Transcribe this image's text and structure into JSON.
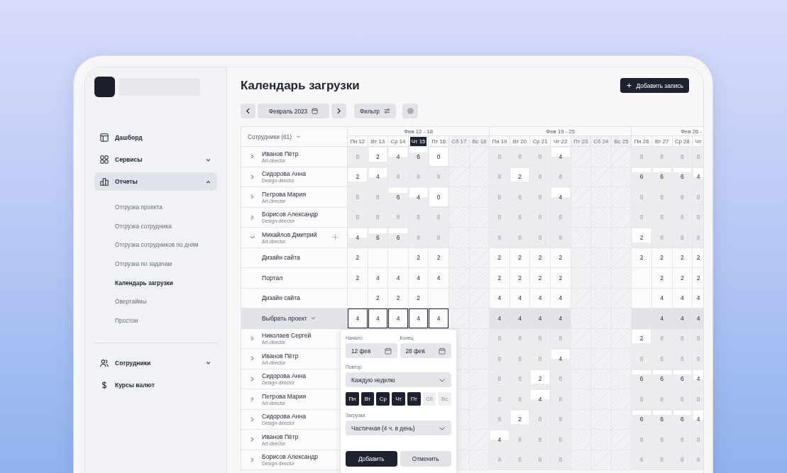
{
  "sidebar": {
    "nav": [
      {
        "label": "Дашборд",
        "kind": "link",
        "selected": false
      },
      {
        "label": "Сервисы",
        "kind": "group",
        "expanded": false,
        "selected": false
      },
      {
        "label": "Отчеты",
        "kind": "group",
        "expanded": true,
        "selected": true,
        "children": [
          {
            "label": "Отгрузка проекта",
            "selected": false
          },
          {
            "label": "Отгрузка сотрудника",
            "selected": false
          },
          {
            "label": "Отгрузка сотрудников по дням",
            "selected": false
          },
          {
            "label": "Отгрузка по задачам",
            "selected": false
          },
          {
            "label": "Календарь загрузки",
            "selected": true
          },
          {
            "label": "Овертаймы",
            "selected": false
          },
          {
            "label": "Простои",
            "selected": false
          }
        ]
      }
    ],
    "nav_bottom": [
      {
        "label": "Сотрудники",
        "kind": "group",
        "expanded": false,
        "selected": false
      },
      {
        "label": "Курсы валют",
        "kind": "link",
        "selected": false
      }
    ]
  },
  "title": "Календарь загрузки",
  "add_button": "Добавить запись",
  "month": "Февраль 2023",
  "filter_button": "Фильтр",
  "employees_header": "Сотрудники (61)",
  "weeks": [
    {
      "label": "Фев 12 - 18"
    },
    {
      "label": "Фев 19 - 25"
    },
    {
      "label": "Фев 26 -"
    }
  ],
  "days": [
    {
      "label": "Пн 12",
      "day_off": false,
      "today": false
    },
    {
      "label": "Вт 13",
      "day_off": false,
      "today": false
    },
    {
      "label": "Ср 14",
      "day_off": false,
      "today": false
    },
    {
      "label": "Чт 15",
      "day_off": false,
      "today": true
    },
    {
      "label": "Пт 16",
      "day_off": false,
      "today": false
    },
    {
      "label": "Сб 17",
      "day_off": true,
      "today": false
    },
    {
      "label": "Вс 18",
      "day_off": true,
      "today": false
    },
    {
      "label": "Пн 19",
      "day_off": false,
      "today": false
    },
    {
      "label": "Вт 20",
      "day_off": false,
      "today": false
    },
    {
      "label": "Ср 21",
      "day_off": false,
      "today": false
    },
    {
      "label": "Чт 22",
      "day_off": false,
      "today": false
    },
    {
      "label": "Пт 23",
      "day_off": true,
      "today": false
    },
    {
      "label": "Сб 24",
      "day_off": true,
      "today": false
    },
    {
      "label": "Вс 25",
      "day_off": true,
      "today": false
    },
    {
      "label": "Пн 26",
      "day_off": false,
      "today": false
    },
    {
      "label": "Вт 27",
      "day_off": false,
      "today": false
    },
    {
      "label": "Ср 28",
      "day_off": false,
      "today": false
    },
    {
      "label": "Чт",
      "day_off": false,
      "today": false
    }
  ],
  "rows": [
    {
      "kind": "employee",
      "name": "Иванов Пётр",
      "role": "Art-director",
      "expanded": false,
      "cells": [
        {
          "text": "8",
          "level": 1
        },
        {
          "text": "2",
          "level": 0.25
        },
        {
          "text": "4",
          "level": 0.5
        },
        {
          "text": "6",
          "level": 0.75
        },
        {
          "text": "0",
          "level": 0
        },
        null,
        null,
        {
          "text": "8",
          "level": 1
        },
        {
          "text": "8",
          "level": 1
        },
        {
          "text": "8",
          "level": 1
        },
        {
          "text": "4",
          "level": 0.5
        },
        null,
        null,
        null,
        {
          "text": "8",
          "level": 1
        },
        {
          "text": "8",
          "level": 1
        },
        {
          "text": "8",
          "level": 1
        },
        {
          "text": "8",
          "level": 1
        }
      ]
    },
    {
      "kind": "employee",
      "name": "Сидорова Анна",
      "role": "Design-director",
      "expanded": false,
      "cells": [
        {
          "text": "2",
          "level": 0.25
        },
        {
          "text": "4",
          "level": 0.5
        },
        {
          "text": "8",
          "level": 1
        },
        {
          "text": "8",
          "level": 1
        },
        {
          "text": "8",
          "level": 1
        },
        null,
        null,
        {
          "text": "8",
          "level": 1
        },
        {
          "text": "2",
          "level": 0.25
        },
        {
          "text": "8",
          "level": 1
        },
        {
          "text": "8",
          "level": 1
        },
        null,
        null,
        null,
        {
          "text": "6",
          "level": 0.75
        },
        {
          "text": "6",
          "level": 0.75
        },
        {
          "text": "6",
          "level": 0.75
        },
        {
          "text": "4",
          "level": 0.5
        }
      ]
    },
    {
      "kind": "employee",
      "name": "Петрова Мария",
      "role": "Art-director",
      "expanded": false,
      "cells": [
        {
          "text": "8",
          "level": 1
        },
        {
          "text": "8",
          "level": 1
        },
        {
          "text": "6",
          "level": 0.75
        },
        {
          "text": "4",
          "level": 0.5
        },
        {
          "text": "0",
          "level": 0
        },
        null,
        null,
        {
          "text": "8",
          "level": 1
        },
        {
          "text": "8",
          "level": 1
        },
        {
          "text": "8",
          "level": 1
        },
        {
          "text": "4",
          "level": 0.5
        },
        null,
        null,
        null,
        {
          "text": "8",
          "level": 1
        },
        {
          "text": "8",
          "level": 1
        },
        {
          "text": "8",
          "level": 1
        },
        {
          "text": "8",
          "level": 1
        }
      ]
    },
    {
      "kind": "employee",
      "name": "Борисов Александр",
      "role": "Design-director",
      "expanded": false,
      "cells": [
        {
          "text": "8",
          "level": 1
        },
        {
          "text": "8",
          "level": 1
        },
        {
          "text": "8",
          "level": 1
        },
        {
          "text": "8",
          "level": 1
        },
        {
          "text": "8",
          "level": 1
        },
        null,
        null,
        {
          "text": "8",
          "level": 1
        },
        {
          "text": "8",
          "level": 1
        },
        {
          "text": "8",
          "level": 1
        },
        {
          "text": "8",
          "level": 1
        },
        null,
        null,
        null,
        {
          "text": "8",
          "level": 1
        },
        {
          "text": "8",
          "level": 1
        },
        {
          "text": "8",
          "level": 1
        },
        {
          "text": "8",
          "level": 1
        }
      ]
    },
    {
      "kind": "employee",
      "name": "Михайлов Дмитрий",
      "role": "Art-director",
      "expanded": true,
      "cells": [
        {
          "text": "4",
          "level": 0.5
        },
        {
          "text": "6",
          "level": 0.75
        },
        {
          "text": "6",
          "level": 0.75
        },
        {
          "text": "8",
          "level": 1
        },
        {
          "text": "8",
          "level": 1
        },
        null,
        null,
        {
          "text": "8",
          "level": 1
        },
        {
          "text": "8",
          "level": 1
        },
        {
          "text": "8",
          "level": 1
        },
        {
          "text": "8",
          "level": 1
        },
        null,
        null,
        null,
        {
          "text": "2",
          "level": 0.25
        },
        {
          "text": "8",
          "level": 1
        },
        {
          "text": "8",
          "level": 1
        },
        {
          "text": "8",
          "level": 1
        }
      ]
    },
    {
      "kind": "task",
      "name": "Дизайн сайта",
      "cells": [
        "2",
        null,
        null,
        "2",
        "2",
        null,
        null,
        "2",
        "2",
        "2",
        "2",
        null,
        null,
        null,
        "2",
        "2",
        "2",
        "2"
      ]
    },
    {
      "kind": "task",
      "name": "Портал",
      "cells": [
        "2",
        "4",
        "4",
        "4",
        "4",
        null,
        null,
        "2",
        "2",
        "2",
        "2",
        null,
        null,
        null,
        null,
        "2",
        "2",
        "2"
      ]
    },
    {
      "kind": "task",
      "name": "Дизайн сайта",
      "cells": [
        null,
        "2",
        "2",
        "2",
        null,
        null,
        null,
        "4",
        "4",
        "4",
        "4",
        null,
        null,
        null,
        null,
        "4",
        "4",
        "4"
      ]
    },
    {
      "kind": "picker",
      "name": "Выбрать проект",
      "cells": [
        {
          "text": "4",
          "selected": true
        },
        {
          "text": "4",
          "selected": true
        },
        {
          "text": "4",
          "selected": true
        },
        {
          "text": "4",
          "selected": true
        },
        {
          "text": "4",
          "selected": true
        },
        null,
        null,
        {
          "text": "4",
          "selected": false
        },
        {
          "text": "4",
          "selected": false
        },
        {
          "text": "4",
          "selected": false
        },
        {
          "text": "4",
          "selected": false
        },
        null,
        null,
        null,
        null,
        {
          "text": "4",
          "selected": false
        },
        {
          "text": "4",
          "selected": false
        },
        {
          "text": "4",
          "selected": false
        }
      ]
    },
    {
      "kind": "employee",
      "name": "Николаев Сергей",
      "role": "Art-director",
      "expanded": false,
      "cells": [
        null,
        null,
        null,
        null,
        null,
        null,
        null,
        {
          "text": "8",
          "level": 1
        },
        {
          "text": "8",
          "level": 1
        },
        {
          "text": "8",
          "level": 1
        },
        {
          "text": "8",
          "level": 1
        },
        null,
        null,
        null,
        {
          "text": "2",
          "level": 0.25
        },
        {
          "text": "8",
          "level": 1
        },
        {
          "text": "8",
          "level": 1
        },
        {
          "text": "8",
          "level": 1
        }
      ]
    },
    {
      "kind": "employee",
      "name": "Иванов Пётр",
      "role": "Art-director",
      "expanded": false,
      "cells": [
        null,
        null,
        null,
        null,
        null,
        null,
        null,
        {
          "text": "8",
          "level": 1
        },
        {
          "text": "8",
          "level": 1
        },
        {
          "text": "8",
          "level": 1
        },
        {
          "text": "4",
          "level": 0.5
        },
        null,
        null,
        null,
        {
          "text": "8",
          "level": 1
        },
        {
          "text": "8",
          "level": 1
        },
        {
          "text": "8",
          "level": 1
        },
        {
          "text": "8",
          "level": 1
        }
      ]
    },
    {
      "kind": "employee",
      "name": "Сидорова Анна",
      "role": "Design-director",
      "expanded": false,
      "cells": [
        null,
        null,
        null,
        null,
        null,
        null,
        null,
        {
          "text": "8",
          "level": 1
        },
        {
          "text": "8",
          "level": 1
        },
        {
          "text": "2",
          "level": 0.25
        },
        {
          "text": "8",
          "level": 1
        },
        null,
        null,
        null,
        {
          "text": "6",
          "level": 0.75
        },
        {
          "text": "6",
          "level": 0.75
        },
        {
          "text": "6",
          "level": 0.75
        },
        {
          "text": "4",
          "level": 0.5
        }
      ]
    },
    {
      "kind": "employee",
      "name": "Петрова Мария",
      "role": "Art-director",
      "expanded": false,
      "cells": [
        null,
        null,
        null,
        null,
        null,
        null,
        null,
        {
          "text": "8",
          "level": 1
        },
        {
          "text": "8",
          "level": 1
        },
        {
          "text": "4",
          "level": 0.5
        },
        {
          "text": "8",
          "level": 1
        },
        null,
        null,
        null,
        {
          "text": "8",
          "level": 1
        },
        {
          "text": "8",
          "level": 1
        },
        {
          "text": "8",
          "level": 1
        },
        {
          "text": "8",
          "level": 1
        }
      ]
    },
    {
      "kind": "employee",
      "name": "Сидорова Анна",
      "role": "Design-director",
      "expanded": false,
      "cells": [
        null,
        null,
        null,
        null,
        null,
        null,
        null,
        {
          "text": "8",
          "level": 1
        },
        {
          "text": "2",
          "level": 0.25
        },
        {
          "text": "8",
          "level": 1
        },
        {
          "text": "8",
          "level": 1
        },
        null,
        null,
        null,
        {
          "text": "6",
          "level": 0.75
        },
        {
          "text": "6",
          "level": 0.75
        },
        {
          "text": "6",
          "level": 0.75
        },
        {
          "text": "4",
          "level": 0.5
        }
      ]
    },
    {
      "kind": "employee",
      "name": "Иванов Пётр",
      "role": "Art-director",
      "expanded": false,
      "cells": [
        null,
        null,
        null,
        null,
        null,
        null,
        null,
        {
          "text": "4",
          "level": 0.5
        },
        {
          "text": "8",
          "level": 1
        },
        {
          "text": "8",
          "level": 1
        },
        {
          "text": "8",
          "level": 1
        },
        null,
        null,
        null,
        {
          "text": "8",
          "level": 1
        },
        {
          "text": "8",
          "level": 1
        },
        {
          "text": "8",
          "level": 1
        },
        {
          "text": "8",
          "level": 1
        }
      ]
    },
    {
      "kind": "employee",
      "name": "Борисов Александр",
      "role": "Design-director",
      "expanded": false,
      "cells": [
        null,
        null,
        null,
        null,
        null,
        null,
        null,
        {
          "text": "8",
          "level": 1
        },
        {
          "text": "8",
          "level": 1
        },
        {
          "text": "8",
          "level": 1
        },
        {
          "text": "8",
          "level": 1
        },
        null,
        null,
        null,
        {
          "text": "8",
          "level": 1
        },
        {
          "text": "8",
          "level": 1
        },
        {
          "text": "8",
          "level": 1
        },
        {
          "text": "8",
          "level": 1
        }
      ]
    }
  ],
  "popup": {
    "start_label": "Начало",
    "start": "12 фев",
    "end_label": "Конец",
    "end": "28 фев",
    "repeat_label": "Повтор",
    "repeat": "Каждую неделю",
    "weekdays": [
      {
        "label": "Пн",
        "selected": true
      },
      {
        "label": "Вт",
        "selected": true
      },
      {
        "label": "Ср",
        "selected": true
      },
      {
        "label": "Чт",
        "selected": true
      },
      {
        "label": "Пт",
        "selected": true
      },
      {
        "label": "Сб",
        "selected": false
      },
      {
        "label": "Вс",
        "selected": false
      }
    ],
    "load_label": "Загрузка",
    "load": "Частичная (4 ч. в день)",
    "buttons": [
      "Добавить",
      "Отменить"
    ]
  }
}
